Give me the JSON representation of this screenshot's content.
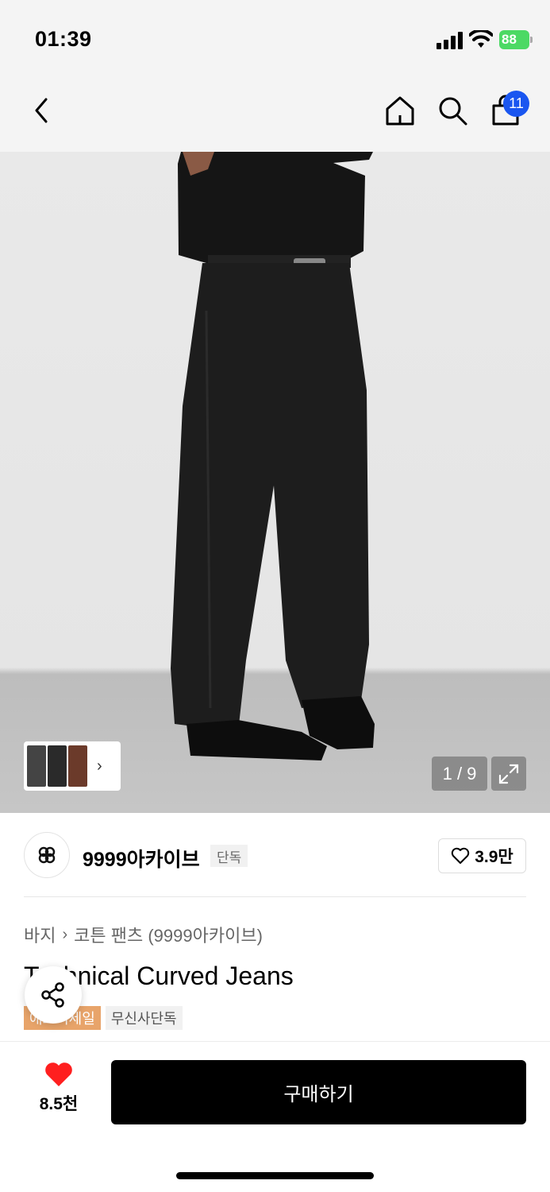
{
  "status_bar": {
    "time": "01:39",
    "battery": "88"
  },
  "nav": {
    "cart_count": "11"
  },
  "gallery": {
    "page_indicator": "1 / 9"
  },
  "brand": {
    "name": "9999아카이브",
    "tag": "단독",
    "likes": "3.9만"
  },
  "breadcrumb": {
    "category": "바지",
    "subcategory": "코튼 팬츠 (9999아카이브)"
  },
  "product": {
    "title": "Technical Curved Jeans",
    "badges": [
      "애프터세일",
      "무신사단독"
    ]
  },
  "bottom": {
    "wish_count": "8.5천",
    "buy_label": "구매하기"
  },
  "colors": {
    "badge_sale": "#e8a46a",
    "cart_badge": "#1a56f0",
    "heart": "#ff1f1f",
    "battery": "#4cd964"
  }
}
